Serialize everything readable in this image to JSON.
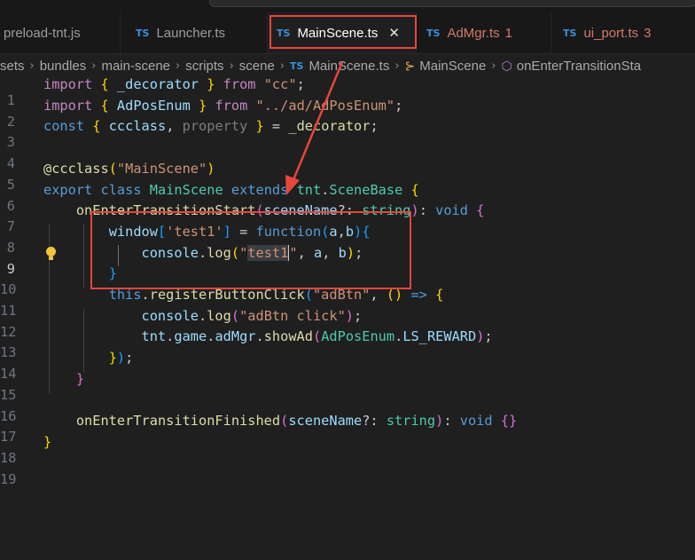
{
  "tabs": [
    {
      "label": "preload-tnt.js",
      "type": "",
      "count": ""
    },
    {
      "label": "Launcher.ts",
      "type": "TS",
      "count": ""
    },
    {
      "label": "MainScene.ts",
      "type": "TS",
      "count": "",
      "close": "✕"
    },
    {
      "label": "AdMgr.ts",
      "type": "TS",
      "count": "1"
    },
    {
      "label": "ui_port.ts",
      "type": "TS",
      "count": "3"
    }
  ],
  "breadcrumb": {
    "items": [
      "sets",
      "bundles",
      "main-scene",
      "scripts",
      "scene"
    ],
    "file_type": "TS",
    "file": "MainScene.ts",
    "class_name": "MainScene",
    "method_name": "onEnterTransitionSta"
  },
  "editor": {
    "line_numbers": [
      "1",
      "2",
      "3",
      "4",
      "5",
      "6",
      "7",
      "8",
      "9",
      "10",
      "11",
      "12",
      "13",
      "14",
      "15",
      "16",
      "17",
      "18",
      "19"
    ],
    "code": {
      "l1": {
        "import": "import",
        "lb": "{",
        "name": " _decorator ",
        "rb": "}",
        "from": "from",
        "src": "\"cc\"",
        "end": ";"
      },
      "l2": {
        "import": "import",
        "lb": "{",
        "name": " AdPosEnum ",
        "rb": "}",
        "from": "from",
        "src": "\"../ad/AdPosEnum\"",
        "end": ";"
      },
      "l3": {
        "const": "const",
        "lb": "{",
        "a": " ccclass",
        "comma": ", ",
        "b": "property ",
        "rb": "}",
        "eq": " = ",
        "c": "_decorator",
        "end": ";"
      },
      "l5": {
        "at": "@ccclass",
        "lp": "(",
        "s": "\"MainScene\"",
        "rp": ")"
      },
      "l6": {
        "export": "export",
        "cls": "class",
        "name": "MainScene",
        "ext": "extends",
        "base1": "tnt",
        "dot": ".",
        "base2": "SceneBase",
        "lb": "{"
      },
      "l7": {
        "fn": "onEnterTransitionStart",
        "lp": "(",
        "p": "sceneName",
        "q": "?: ",
        "t": "string",
        "rp": ")",
        "ret": ": ",
        "v": "void",
        "lb": "{"
      },
      "l8": {
        "w": "window",
        "lb": "[",
        "s": "'test1'",
        "rb": "]",
        "eq": " = ",
        "fn": "function",
        "lp": "(",
        "a": "a",
        "c": ",",
        "b": "b",
        "rp": ")",
        "bo": "{"
      },
      "l9": {
        "obj": "console",
        "dot": ".",
        "fn": "log",
        "lp": "(",
        "q1": "\"",
        "s": "test1",
        "q2": "\"",
        "rest1": ", ",
        "a": "a",
        "rest2": ", ",
        "b": "b",
        "rp": ")",
        "end": ";"
      },
      "l10": {
        "rb": "}"
      },
      "l11": {
        "th": "this",
        "dot": ".",
        "fn": "registerButtonClick",
        "lp": "(",
        "s": "\"adBtn\"",
        "c": ", ",
        "ap": "()",
        "ar": " => ",
        "bo": "{"
      },
      "l12": {
        "obj": "console",
        "dot": ".",
        "fn": "log",
        "lp": "(",
        "s": "\"adBtn click\"",
        "rp": ")",
        "end": ";"
      },
      "l13": {
        "a": "tnt",
        "d1": ".",
        "b": "game",
        "d2": ".",
        "c": "adMgr",
        "d3": ".",
        "fn": "showAd",
        "lp": "(",
        "e": "AdPosEnum",
        "d4": ".",
        "f": "LS_REWARD",
        "rp": ")",
        "end": ";"
      },
      "l14": {
        "rb": "}",
        "rp": ")",
        "end": ";"
      },
      "l15": {
        "rb": "}"
      },
      "l17": {
        "fn": "onEnterTransitionFinished",
        "lp": "(",
        "p": "sceneName",
        "q": "?: ",
        "t": "string",
        "rp": ")",
        "ret": ": ",
        "v": "void",
        "body": "{}"
      },
      "l18": {
        "rb": "}"
      }
    }
  },
  "colors": {
    "annotation": "#e8453c",
    "keyword": "#569cd6",
    "string": "#ce9178",
    "function": "#dcdcaa"
  }
}
